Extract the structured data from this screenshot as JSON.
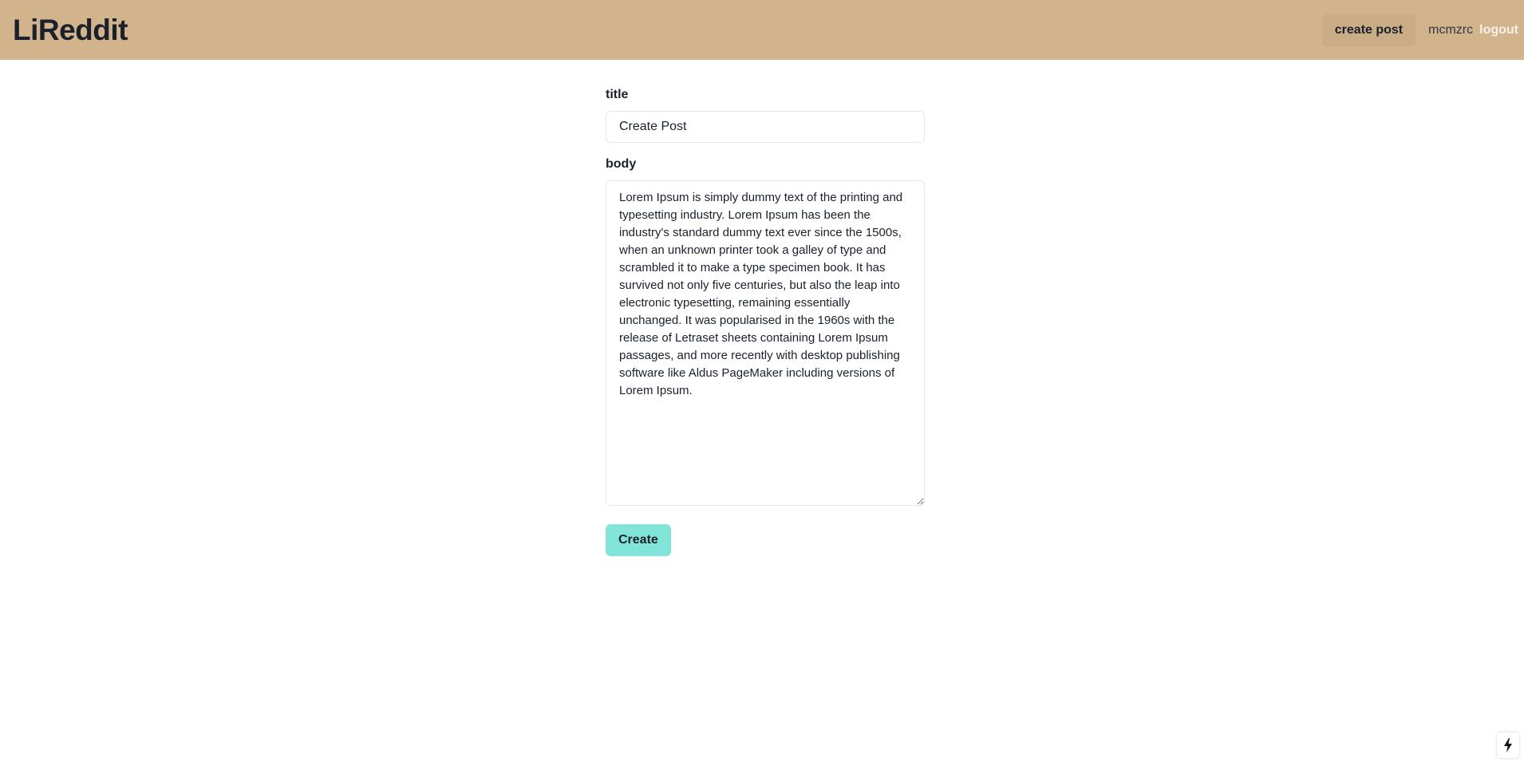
{
  "navbar": {
    "logo": "LiReddit",
    "create_post_label": "create post",
    "username": "mcmzrc",
    "logout_label": "logout",
    "background_color": "#d2b48c"
  },
  "form": {
    "title_label": "title",
    "title_value": "Create Post",
    "body_label": "body",
    "body_value": "Lorem Ipsum is simply dummy text of the printing and typesetting industry. Lorem Ipsum has been the industry's standard dummy text ever since the 1500s, when an unknown printer took a galley of type and scrambled it to make a type specimen book. It has survived not only five centuries, but also the leap into electronic typesetting, remaining essentially unchanged. It was popularised in the 1960s with the release of Letraset sheets containing Lorem Ipsum passages, and more recently with desktop publishing software like Aldus PageMaker including versions of Lorem Ipsum.",
    "submit_label": "Create",
    "submit_color": "#81e6d9"
  },
  "corner_badge": {
    "icon": "lightning-bolt-icon"
  }
}
